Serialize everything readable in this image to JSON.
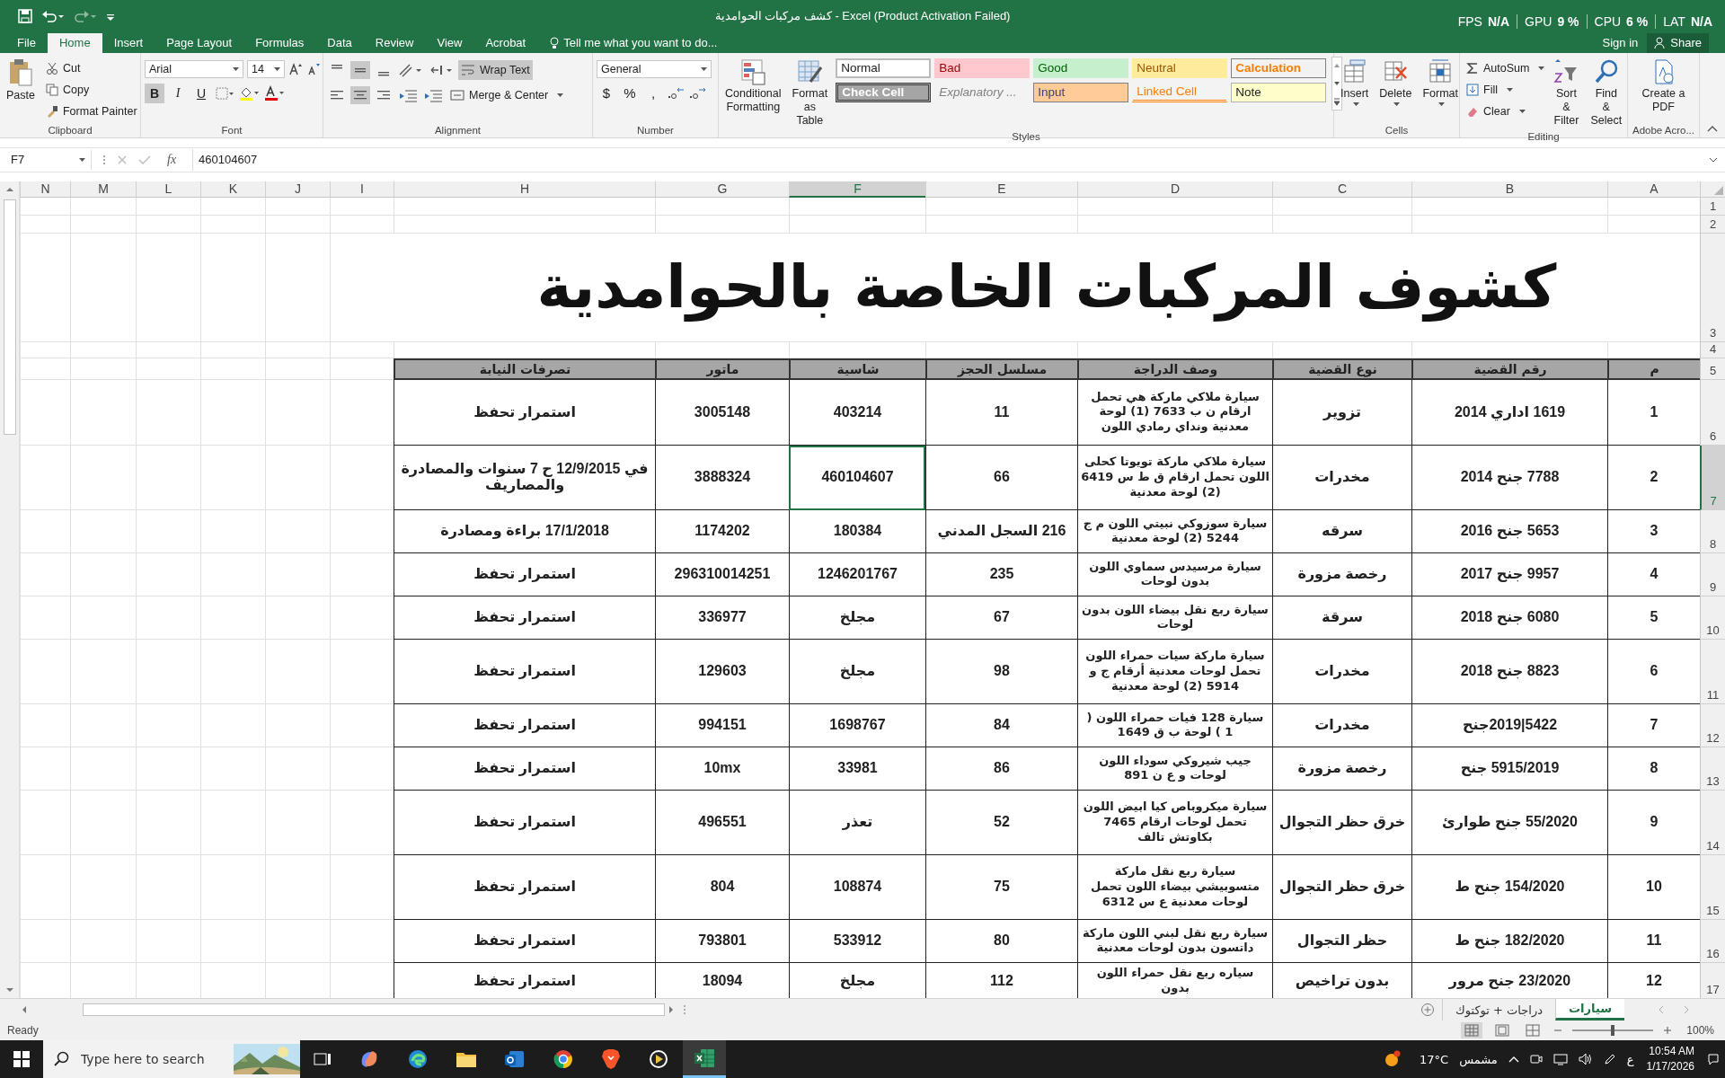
{
  "window": {
    "title": "كشف مركبات الحوامدية - Excel (Product Activation Failed)",
    "stats": {
      "fps": {
        "label": "FPS",
        "value": "N/A"
      },
      "gpu": {
        "label": "GPU",
        "value": "9 %"
      },
      "cpu": {
        "label": "CPU",
        "value": "6 %"
      },
      "lat": {
        "label": "LAT",
        "value": "N/A"
      }
    },
    "sign_in": "Sign in",
    "share": "Share"
  },
  "ribbon": {
    "tabs": {
      "file": {
        "label": "File",
        "selected": false
      },
      "home": {
        "label": "Home",
        "selected": true
      },
      "insert": {
        "label": "Insert",
        "selected": false
      },
      "page_layout": {
        "label": "Page Layout",
        "selected": false
      },
      "formulas": {
        "label": "Formulas",
        "selected": false
      },
      "data": {
        "label": "Data",
        "selected": false
      },
      "review": {
        "label": "Review",
        "selected": false
      },
      "view": {
        "label": "View",
        "selected": false
      },
      "acrobat": {
        "label": "Acrobat",
        "selected": false
      }
    },
    "tell_me": "Tell me what you want to do...",
    "clipboard": {
      "name": "Clipboard",
      "paste": "Paste",
      "cut": "Cut",
      "copy": "Copy",
      "format_painter": "Format Painter"
    },
    "font": {
      "name": "Font",
      "family": "Arial",
      "size": "14",
      "styles": {
        "bold": {
          "label": "B",
          "on": true
        },
        "italic": {
          "label": "I",
          "on": false
        },
        "underline": {
          "label": "U",
          "on": false
        }
      }
    },
    "alignment": {
      "name": "Alignment",
      "wrap_text": {
        "label": "Wrap Text",
        "on": true
      },
      "merge": "Merge & Center",
      "vertical": [
        {
          "selected": false
        },
        {
          "selected": true
        },
        {
          "selected": false
        }
      ],
      "horizontal": [
        {
          "selected": false
        },
        {
          "selected": true
        },
        {
          "selected": false
        }
      ]
    },
    "number": {
      "name": "Number",
      "format": "General",
      "symbols": {
        "currency": "$",
        "percent": "%",
        "comma": ","
      }
    },
    "styles": {
      "name": "Styles",
      "conditional": "Conditional Formatting",
      "format_table": "Format as Table",
      "gallery": {
        "normal": "Normal",
        "bad": "Bad",
        "good": "Good",
        "neutral": "Neutral",
        "calculation": "Calculation",
        "check": "Check Cell",
        "explanatory": "Explanatory ...",
        "input": "Input",
        "linked": "Linked Cell",
        "note": "Note"
      }
    },
    "cells": {
      "name": "Cells",
      "buttons": {
        "insert": "Insert",
        "delete": "Delete",
        "format": "Format"
      }
    },
    "editing": {
      "name": "Editing",
      "autosum": "AutoSum",
      "fill": "Fill",
      "clear": "Clear",
      "sort": "Sort & Filter",
      "find": "Find & Select"
    },
    "adobe": {
      "name": "Adobe Acro...",
      "create": "Create a PDF"
    }
  },
  "formula_bar": {
    "name_box": "F7",
    "fx": "fx",
    "value": "460104607"
  },
  "sheet": {
    "column_headers": [
      {
        "label": "A",
        "selected": false
      },
      {
        "label": "B",
        "selected": false
      },
      {
        "label": "C",
        "selected": false
      },
      {
        "label": "D",
        "selected": false
      },
      {
        "label": "E",
        "selected": false
      },
      {
        "label": "F",
        "selected": true
      },
      {
        "label": "G",
        "selected": false
      },
      {
        "label": "H",
        "selected": false
      },
      {
        "label": "I",
        "selected": false
      },
      {
        "label": "J",
        "selected": false
      },
      {
        "label": "K",
        "selected": false
      },
      {
        "label": "L",
        "selected": false
      },
      {
        "label": "M",
        "selected": false
      },
      {
        "label": "N",
        "selected": false
      }
    ],
    "row_numbers": [
      {
        "label": "1",
        "selected": false
      },
      {
        "label": "2",
        "selected": false
      },
      {
        "label": "3",
        "selected": false
      },
      {
        "label": "4",
        "selected": false
      },
      {
        "label": "5",
        "selected": false
      },
      {
        "label": "6",
        "selected": false
      },
      {
        "label": "7",
        "selected": true
      },
      {
        "label": "8",
        "selected": false
      },
      {
        "label": "9",
        "selected": false
      },
      {
        "label": "10",
        "selected": false
      },
      {
        "label": "11",
        "selected": false
      },
      {
        "label": "12",
        "selected": false
      },
      {
        "label": "13",
        "selected": false
      },
      {
        "label": "14",
        "selected": false
      },
      {
        "label": "15",
        "selected": false
      },
      {
        "label": "16",
        "selected": false
      },
      {
        "label": "17",
        "selected": false
      }
    ],
    "title": "كشوف المركبات الخاصة بالحوامدية",
    "table": {
      "columns": [
        "م",
        "رقم القضية",
        "نوع القضية",
        "وصف الدراجة",
        "مسلسل الحجز",
        "شاسية",
        "ماتور",
        "تصرفات النيابة"
      ],
      "rows": [
        [
          "1",
          "1619 اداري 2014",
          "تزوير",
          "سيارة ملاكي ماركة هي تحمل ارقام ن ب 7633 (1) لوحة معدنية ونداي رمادي اللون",
          "11",
          "403214",
          "3005148",
          "استمرار تحفظ"
        ],
        [
          "2",
          "7788 جنح 2014",
          "مخدرات",
          "سيارة ملاكي ماركة تويوتا كحلى اللون تحمل ارقام ق ط س 6419 (2) لوحة معدنية",
          "66",
          "460104607",
          "3888324",
          "في 12/9/2015 ح 7 سنوات والمصادرة والمصاريف"
        ],
        [
          "3",
          "5653 جنح 2016",
          "سرقه",
          "سيارة سوزوكي نبيتي اللون م ج 5244 (2) لوحة معدنية",
          "216 السجل المدني",
          "180384",
          "1174202",
          "17/1/2018 براءة ومصادرة"
        ],
        [
          "4",
          "9957 جنح 2017",
          "رخصة مزورة",
          "سيارة مرسيدس سماوي اللون بدون لوحات",
          "235",
          "1246201767",
          "296310014251",
          "استمرار تحفظ"
        ],
        [
          "5",
          "6080 جنح 2018",
          "سرقة",
          "سيارة ربع نقل بيضاء اللون بدون لوحات",
          "67",
          "مجلخ",
          "336977",
          "استمرار تحفظ"
        ],
        [
          "6",
          "8823 جنح 2018",
          "مخدرات",
          "سيارة ماركة سيات حمراء اللون تحمل لوحات معدنية أرقام ج و 5914 (2) لوحة معدنية",
          "98",
          "مجلخ",
          "129603",
          "استمرار تحفظ"
        ],
        [
          "7",
          "5422|2019جنح",
          "مخدرات",
          "سيارة 128 فيات حمراء اللون ( 1 ) لوحة ب ق 1649",
          "84",
          "1698767",
          "994151",
          "استمرار تحفظ"
        ],
        [
          "8",
          "5915/2019 جنح",
          "رخصة مزورة",
          "جيب شيروكي سوداء اللون لوحات و ع ن 891",
          "86",
          "33981",
          "10mx",
          "استمرار تحفظ"
        ],
        [
          "9",
          "55/2020 جنح طوارئ",
          "خرق حظر التجوال",
          "سيارة ميكروباص كيا ابيض اللون تحمل لوحات ارقام 7465 بكاوتش تالف",
          "52",
          "تعذر",
          "496551",
          "استمرار تحفظ"
        ],
        [
          "10",
          "154/2020 جنح ط",
          "خرق حظر التجوال",
          "سيارة ربع نقل ماركة متسوبيشي بيضاء اللون تحمل لوحات معدنية ع س 6312",
          "75",
          "108874",
          "804",
          "استمرار تحفظ"
        ],
        [
          "11",
          "182/2020 جنح ط",
          "حظر التجوال",
          "سيارة ربع نقل لبني اللون ماركة داتسون بدون لوحات معدنية",
          "80",
          "533912",
          "793801",
          "استمرار تحفظ"
        ],
        [
          "12",
          "23/2020 جنح مرور",
          "بدون تراخيص",
          "سياره ربع نقل حمراء اللون بدون",
          "112",
          "مجلخ",
          "18094",
          "استمرار تحفظ"
        ]
      ]
    },
    "sheet_tabs": [
      {
        "label": "سيارات",
        "selected": true
      },
      {
        "label": "دراجات + توكتوك",
        "selected": false
      }
    ]
  },
  "status_bar": {
    "status": "Ready",
    "zoom": "100%",
    "zoom_slider": {
      "level": 0.5
    }
  },
  "taskbar": {
    "search_placeholder": "Type here to search",
    "temperature": "17°C",
    "weather": "مشمس",
    "language": "ع",
    "time": "10:54 AM",
    "date": "1/17/2026"
  }
}
